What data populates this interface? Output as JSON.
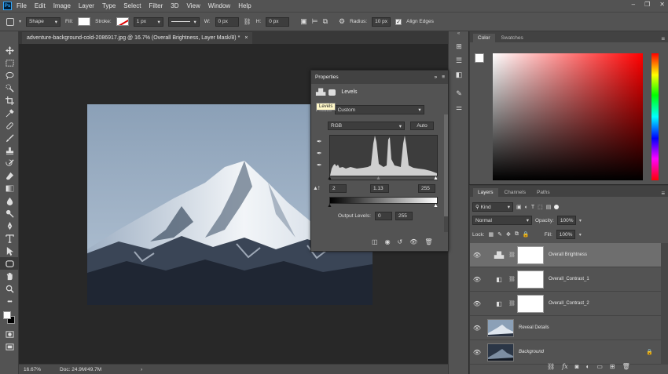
{
  "app": {
    "logo_text": "Ps"
  },
  "menu": [
    "File",
    "Edit",
    "Image",
    "Layer",
    "Type",
    "Select",
    "Filter",
    "3D",
    "View",
    "Window",
    "Help"
  ],
  "window_controls": [
    "–",
    "❐",
    "✕"
  ],
  "options_bar": {
    "mode": "Shape",
    "fill_label": "Fill:",
    "stroke_label": "Stroke:",
    "stroke_width": "1 px",
    "w_label": "W:",
    "w_value": "0 px",
    "h_label": "H:",
    "h_value": "0 px",
    "radius_label": "Radius:",
    "radius_value": "10 px",
    "align_edges": "Align Edges"
  },
  "document_tab": {
    "title": "adventure-background-cold-2086917.jpg @ 16.7% (Overall Brightness, Layer Mask/8) *",
    "close": "×"
  },
  "status": {
    "zoom": "16.67%",
    "doc": "Doc: 24.9M/49.7M",
    "arrow": "›"
  },
  "properties": {
    "tab": "Properties",
    "header_icons": "»",
    "type": "Levels",
    "tooltip": "Levels",
    "preset_label": "Preset:",
    "preset_value": "Custom",
    "channel": "RGB",
    "auto_button": "Auto",
    "input_black": "2",
    "input_gamma": "1.13",
    "input_white": "255",
    "output_label": "Output Levels:",
    "output_black": "0",
    "output_white": "255"
  },
  "color_panel": {
    "tabs": [
      "Color",
      "Swatches"
    ]
  },
  "layers_panel": {
    "tabs": [
      "Layers",
      "Channels",
      "Paths"
    ],
    "filter": "Kind",
    "blend_mode": "Normal",
    "opacity_label": "Opacity:",
    "opacity_value": "100%",
    "lock_label": "Lock:",
    "fill_label": "Fill:",
    "fill_value": "100%",
    "layers": [
      {
        "name": "Overall Brightness",
        "kind": "levels",
        "selected": true
      },
      {
        "name": "Overall_Contrast_1",
        "kind": "gradient",
        "selected": false
      },
      {
        "name": "Overall_Contrast_2",
        "kind": "gradient",
        "selected": false
      },
      {
        "name": "Reveal Details",
        "kind": "image",
        "selected": false
      },
      {
        "name": "Background",
        "kind": "image",
        "selected": false
      }
    ]
  }
}
